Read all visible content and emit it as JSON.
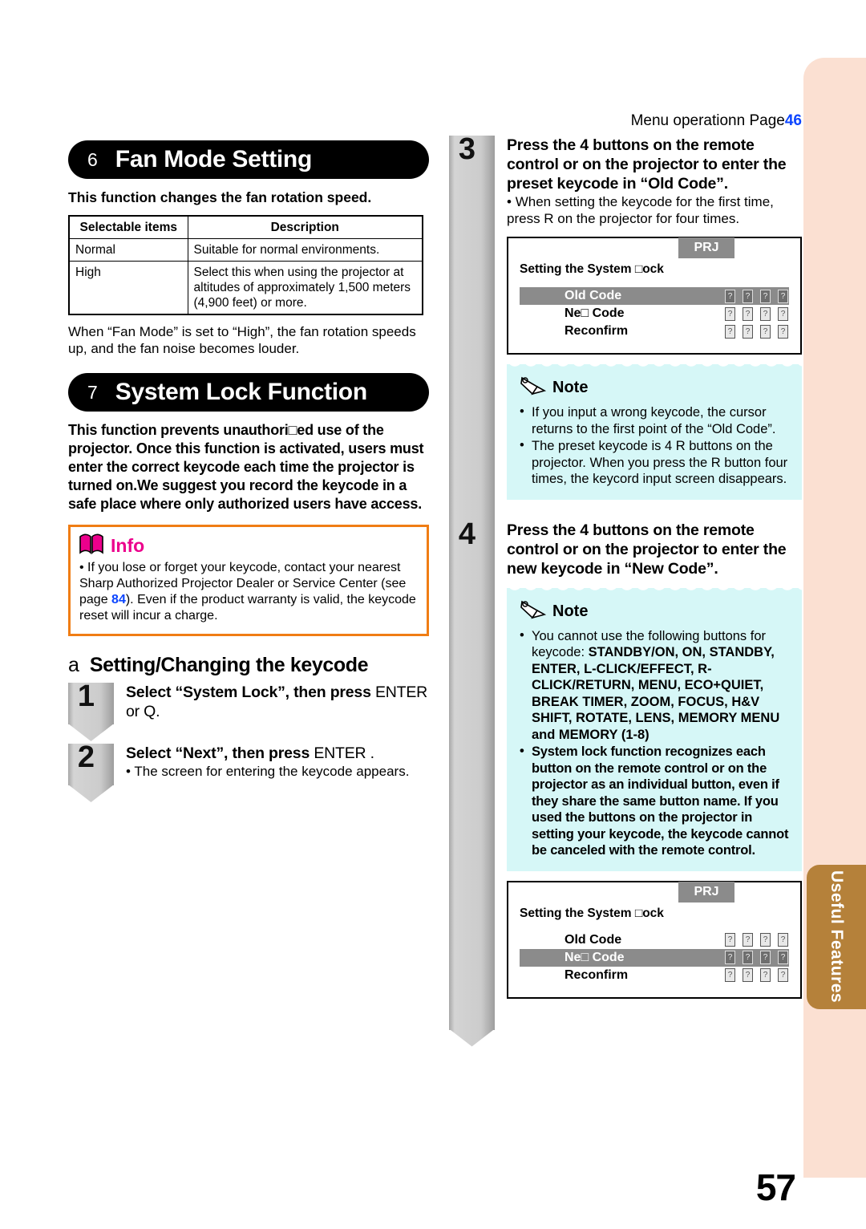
{
  "page": {
    "number": "57",
    "side_tab": "Useful Features",
    "menu_operation": {
      "text": "Menu operationn  Page",
      "page_ref": "46"
    }
  },
  "section_fan": {
    "number": "6",
    "title": "Fan Mode Setting",
    "lead": "This function changes the fan rotation speed.",
    "table": {
      "headers": [
        "Selectable items",
        "Description"
      ],
      "rows": [
        [
          "Normal",
          "Suitable for normal environments."
        ],
        [
          "High",
          "Select this when using the projector at altitudes of approximately 1,500 meters (4,900 feet) or more."
        ]
      ]
    },
    "note_after_table": "When “Fan Mode” is set to “High”, the fan rotation speeds up, and the fan noise becomes louder."
  },
  "section_lock": {
    "number": "7",
    "title": "System Lock Function",
    "intro_normal": "This function prevents unauthori□ed use of the projector. Once this function is activated, users must enter the correct keycode each time the projector is turned on.",
    "intro_bold": "We suggest you record the keycode in a safe place where only authorized users have access.",
    "info": {
      "label": "Info",
      "icon": "book-icon",
      "text_before": "If you lose or forget your keycode, contact your nearest Sharp Authorized Projector Dealer or Service Center (see page ",
      "page_ref": "84",
      "text_after": "). Even if the product warranty is valid, the keycode reset will incur a charge."
    },
    "subsection": {
      "letter": "a",
      "title": "Setting/Changing the keycode"
    }
  },
  "steps": [
    {
      "number": "1",
      "title_bold": "Select “System Lock”, then press",
      "title_rest": "ENTER  or Q.",
      "sub": ""
    },
    {
      "number": "2",
      "title_bold": "Select “Next”, then press",
      "title_rest": "ENTER .",
      "sub": "The screen for entering the keycode appears."
    },
    {
      "number": "3",
      "title_bold": "Press the 4 buttons on the remote control or on the projector to enter the preset keycode in “Old Code”.",
      "title_rest": "",
      "sub": "When setting the keycode for the first time, press R  on the projector for four times."
    },
    {
      "number": "4",
      "title_bold": "Press the 4 buttons on the remote control or on the projector to enter the new keycode in “New Code”.",
      "title_rest": "",
      "sub": ""
    }
  ],
  "osd_1": {
    "prj_badge": "PRJ",
    "title": "Setting the System □ock",
    "rows": [
      {
        "label": "Old Code",
        "highlighted": true,
        "cursor_first": true
      },
      {
        "label": "Ne□ Code",
        "highlighted": false,
        "cursor_first": false
      },
      {
        "label": "Reconfirm",
        "highlighted": false,
        "cursor_first": false
      }
    ],
    "code_glyph": "?"
  },
  "osd_2": {
    "prj_badge": "PRJ",
    "title": "Setting the System □ock",
    "rows": [
      {
        "label": "Old Code",
        "highlighted": false,
        "cursor_first": false
      },
      {
        "label": "Ne□ Code",
        "highlighted": true,
        "cursor_first": true
      },
      {
        "label": "Reconfirm",
        "highlighted": false,
        "cursor_first": false
      }
    ],
    "code_glyph": "?"
  },
  "note_1": {
    "label": "Note",
    "icon": "pencil-icon",
    "items": [
      {
        "text": "If you input a wrong keycode, the cursor returns to the first point of the “Old Code”.",
        "bold": false
      },
      {
        "text": "The preset keycode is 4 R  buttons on the projector. When you press the R button four times, the keycord input screen disappears.",
        "bold": false
      }
    ]
  },
  "note_2": {
    "label": "Note",
    "icon": "pencil-icon",
    "items": [
      {
        "text_plain": "You cannot use the following buttons for keycode: ",
        "text_bold": "STANDBY/ON, ON, STANDBY, ENTER, L-CLICK/EFFECT, R-CLICK/RETURN, MENU, ECO+QUIET, BREAK TIMER, ZOOM, FOCUS, H&V SHIFT, ROTATE, LENS, MEMORY MENU and MEMORY (1-8)",
        "bold": false
      },
      {
        "text": "System lock function recognizes each button on the remote control or on the projector as an individual button, even if they share the same button name. If you used the buttons on the projector in setting your keycode, the keycode cannot be canceled with the remote control.",
        "bold": true
      }
    ]
  },
  "colors": {
    "info_border": "#f07d14",
    "info_label": "#ec008c",
    "page_ref": "#0b44ff",
    "note_bg": "#d6f7f7",
    "side_band": "#fbe0d2",
    "side_tab": "#b5813a",
    "osd_highlight": "#8b8b8b"
  }
}
